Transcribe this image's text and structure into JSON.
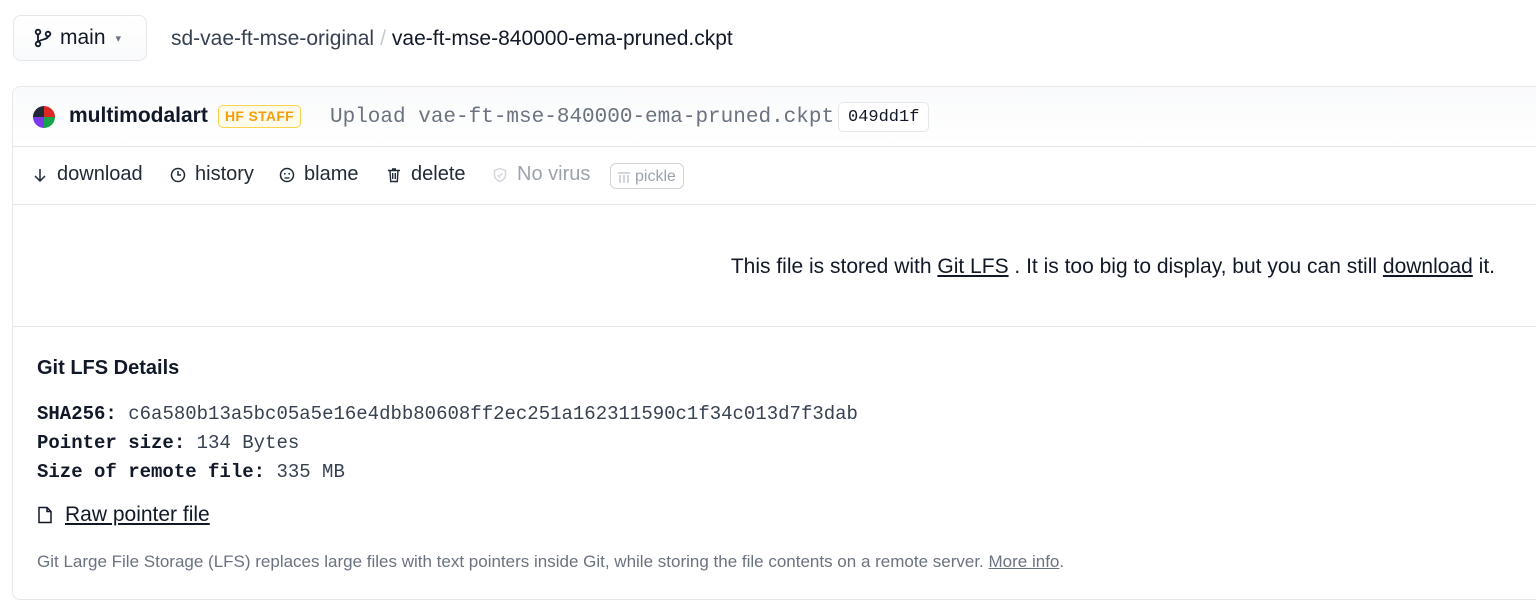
{
  "branch": {
    "label": "main"
  },
  "breadcrumb": {
    "repo": "sd-vae-ft-mse-original",
    "separator": "/",
    "file": "vae-ft-mse-840000-ema-pruned.ckpt"
  },
  "commit": {
    "author": "multimodalart",
    "badge": "HF STAFF",
    "message": "Upload vae-ft-mse-840000-ema-pruned.ckpt",
    "hash": "049dd1f"
  },
  "actions": {
    "download": "download",
    "history": "history",
    "blame": "blame",
    "delete": "delete",
    "virus_status": "No virus",
    "pickle": "pickle"
  },
  "lfs_notice": {
    "prefix": "This file is stored with",
    "link": "Git LFS",
    "middle": ". It is too big to display, but you can still",
    "download_link": "download",
    "suffix": "it."
  },
  "lfs_details": {
    "title": "Git LFS Details",
    "sha_label": "SHA256:",
    "sha_value": "c6a580b13a5bc05a5e16e4dbb80608ff2ec251a162311590c1f34c013d7f3dab",
    "pointer_label": "Pointer size:",
    "pointer_value": "134 Bytes",
    "remote_label": "Size of remote file:",
    "remote_value": "335 MB",
    "raw_pointer": "Raw pointer file",
    "note": "Git Large File Storage (LFS) replaces large files with text pointers inside Git, while storing the file contents on a remote server.",
    "more_info": "More info",
    "note_end": "."
  },
  "colors": {
    "badge": "#f59e0b",
    "muted": "#6b7280",
    "border": "#e5e7eb"
  }
}
